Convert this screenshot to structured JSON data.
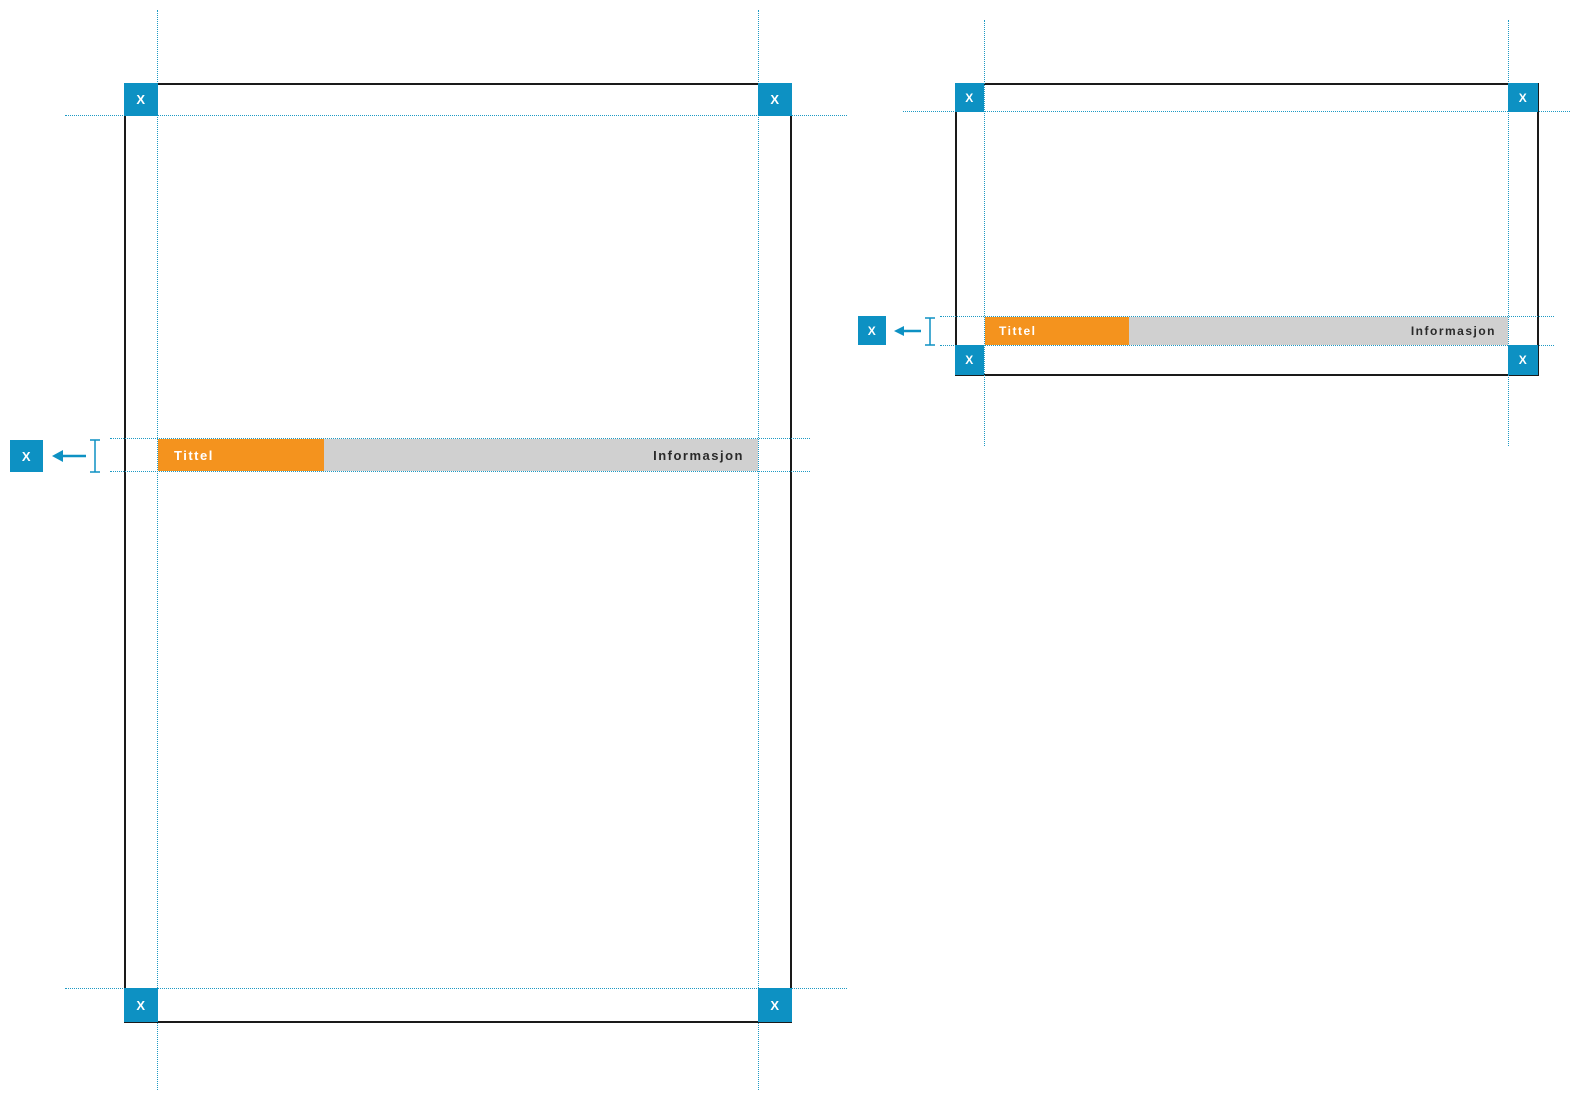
{
  "marker": "X",
  "bar": {
    "title": "Tittel",
    "info": "Informasjon"
  },
  "colors": {
    "accent_blue": "#0d91c3",
    "title_orange": "#f4931e",
    "info_grey": "#d0d0d0",
    "frame": "#1a1a1a"
  },
  "icons": [
    "arrow-left-icon",
    "dimension-bracket-icon"
  ]
}
